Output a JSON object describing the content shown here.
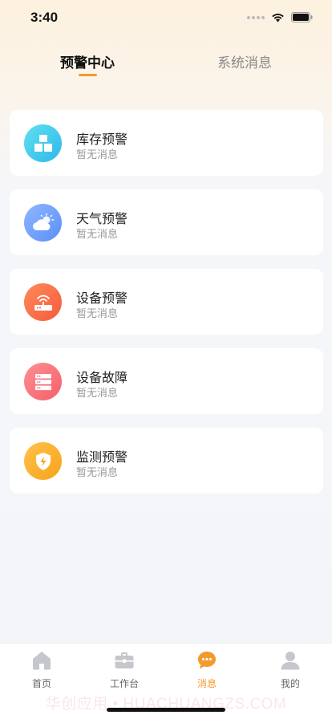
{
  "status_bar": {
    "time": "3:40"
  },
  "tabs": [
    {
      "label": "预警中心",
      "active": true
    },
    {
      "label": "系统消息",
      "active": false
    }
  ],
  "cards": [
    {
      "title": "库存预警",
      "subtitle": "暂无消息",
      "icon": "inventory-boxes-icon",
      "color_from": "#5fe0f0",
      "color_to": "#2eb8ea"
    },
    {
      "title": "天气预警",
      "subtitle": "暂无消息",
      "icon": "weather-cloud-sun-icon",
      "color_from": "#8fb6ff",
      "color_to": "#5b8ff7"
    },
    {
      "title": "设备预警",
      "subtitle": "暂无消息",
      "icon": "router-device-icon",
      "color_from": "#ff8a5a",
      "color_to": "#f75a3c"
    },
    {
      "title": "设备故障",
      "subtitle": "暂无消息",
      "icon": "server-fault-icon",
      "color_from": "#ff8f94",
      "color_to": "#f55e6a"
    },
    {
      "title": "监测预警",
      "subtitle": "暂无消息",
      "icon": "shield-lightning-icon",
      "color_from": "#ffc24a",
      "color_to": "#f7a21b"
    }
  ],
  "tabbar": [
    {
      "label": "首页",
      "icon": "home-icon",
      "active": false
    },
    {
      "label": "工作台",
      "icon": "briefcase-icon",
      "active": false
    },
    {
      "label": "消息",
      "icon": "chat-bubble-icon",
      "active": true
    },
    {
      "label": "我的",
      "icon": "user-icon",
      "active": false
    }
  ],
  "watermark": "华创应用 • HUACHUANGZS.COM",
  "colors": {
    "accent": "#f39a2b",
    "inactive_text": "#888888"
  }
}
